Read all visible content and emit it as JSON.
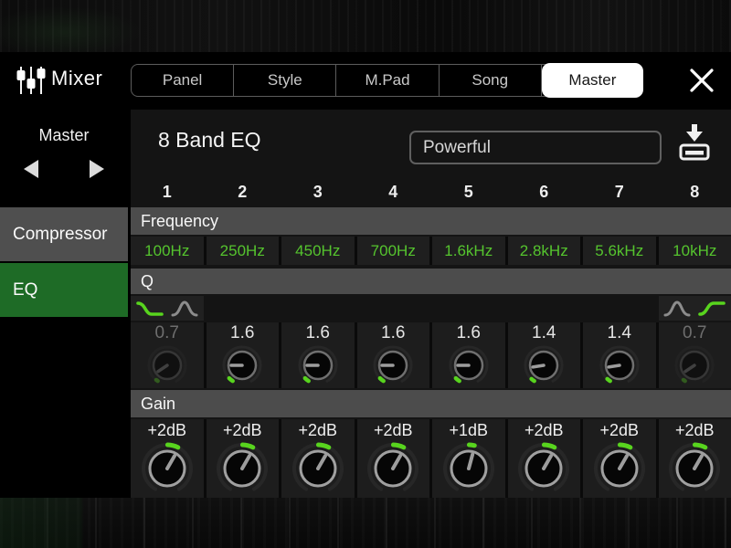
{
  "window": {
    "title": "Mixer"
  },
  "titlebar": {
    "tabs": [
      {
        "label": "Panel",
        "active": false
      },
      {
        "label": "Style",
        "active": false
      },
      {
        "label": "M.Pad",
        "active": false
      },
      {
        "label": "Song",
        "active": false
      },
      {
        "label": "Master",
        "active": true
      }
    ]
  },
  "sidebar": {
    "selector": {
      "label": "Master"
    },
    "items": [
      {
        "label": "Compressor",
        "active": false
      },
      {
        "label": "EQ",
        "active": true
      }
    ]
  },
  "main": {
    "title": "8 Band EQ",
    "preset": {
      "value": "Powerful"
    },
    "row_labels": {
      "frequency": "Frequency",
      "q": "Q",
      "gain": "Gain"
    },
    "bands": [
      {
        "number": "1",
        "frequency": "100Hz",
        "q": "0.7",
        "q_disabled": true,
        "filter_icons": [
          {
            "name": "low-shelf-icon",
            "active": true
          },
          {
            "name": "peak-icon",
            "active": false
          }
        ],
        "q_knob": {
          "pointer_deg": 236,
          "arc": [
            211,
            217
          ]
        },
        "gain": "+2dB",
        "gain_knob": {
          "pointer_deg": 30,
          "arc": [
            1,
            27
          ]
        }
      },
      {
        "number": "2",
        "frequency": "250Hz",
        "q": "1.6",
        "q_disabled": false,
        "q_knob": {
          "pointer_deg": 270,
          "arc": [
            211,
            225
          ]
        },
        "gain": "+2dB",
        "gain_knob": {
          "pointer_deg": 30,
          "arc": [
            1,
            27
          ]
        }
      },
      {
        "number": "3",
        "frequency": "450Hz",
        "q": "1.6",
        "q_disabled": false,
        "q_knob": {
          "pointer_deg": 270,
          "arc": [
            211,
            225
          ]
        },
        "gain": "+2dB",
        "gain_knob": {
          "pointer_deg": 30,
          "arc": [
            1,
            27
          ]
        }
      },
      {
        "number": "4",
        "frequency": "700Hz",
        "q": "1.6",
        "q_disabled": false,
        "q_knob": {
          "pointer_deg": 270,
          "arc": [
            211,
            225
          ]
        },
        "gain": "+2dB",
        "gain_knob": {
          "pointer_deg": 30,
          "arc": [
            1,
            27
          ]
        }
      },
      {
        "number": "5",
        "frequency": "1.6kHz",
        "q": "1.6",
        "q_disabled": false,
        "q_knob": {
          "pointer_deg": 270,
          "arc": [
            211,
            225
          ]
        },
        "gain": "+1dB",
        "gain_knob": {
          "pointer_deg": 15,
          "arc": [
            1,
            14
          ]
        }
      },
      {
        "number": "6",
        "frequency": "2.8kHz",
        "q": "1.4",
        "q_disabled": false,
        "q_knob": {
          "pointer_deg": 261,
          "arc": [
            211,
            222
          ]
        },
        "gain": "+2dB",
        "gain_knob": {
          "pointer_deg": 30,
          "arc": [
            1,
            27
          ]
        }
      },
      {
        "number": "7",
        "frequency": "5.6kHz",
        "q": "1.4",
        "q_disabled": false,
        "q_knob": {
          "pointer_deg": 261,
          "arc": [
            211,
            222
          ]
        },
        "gain": "+2dB",
        "gain_knob": {
          "pointer_deg": 30,
          "arc": [
            1,
            27
          ]
        }
      },
      {
        "number": "8",
        "frequency": "10kHz",
        "q": "0.7",
        "q_disabled": true,
        "filter_icons": [
          {
            "name": "peak-icon",
            "active": false
          },
          {
            "name": "high-shelf-icon",
            "active": true
          }
        ],
        "q_knob": {
          "pointer_deg": 236,
          "arc": [
            211,
            217
          ]
        },
        "gain": "+2dB",
        "gain_knob": {
          "pointer_deg": 30,
          "arc": [
            1,
            27
          ]
        }
      }
    ]
  },
  "colors": {
    "accent_green": "#58d41e",
    "value_green": "#55c42e",
    "selected_item_green": "#1e6b26",
    "header_gray": "#4c4c4c",
    "active_tab_bg": "#ffffff"
  }
}
